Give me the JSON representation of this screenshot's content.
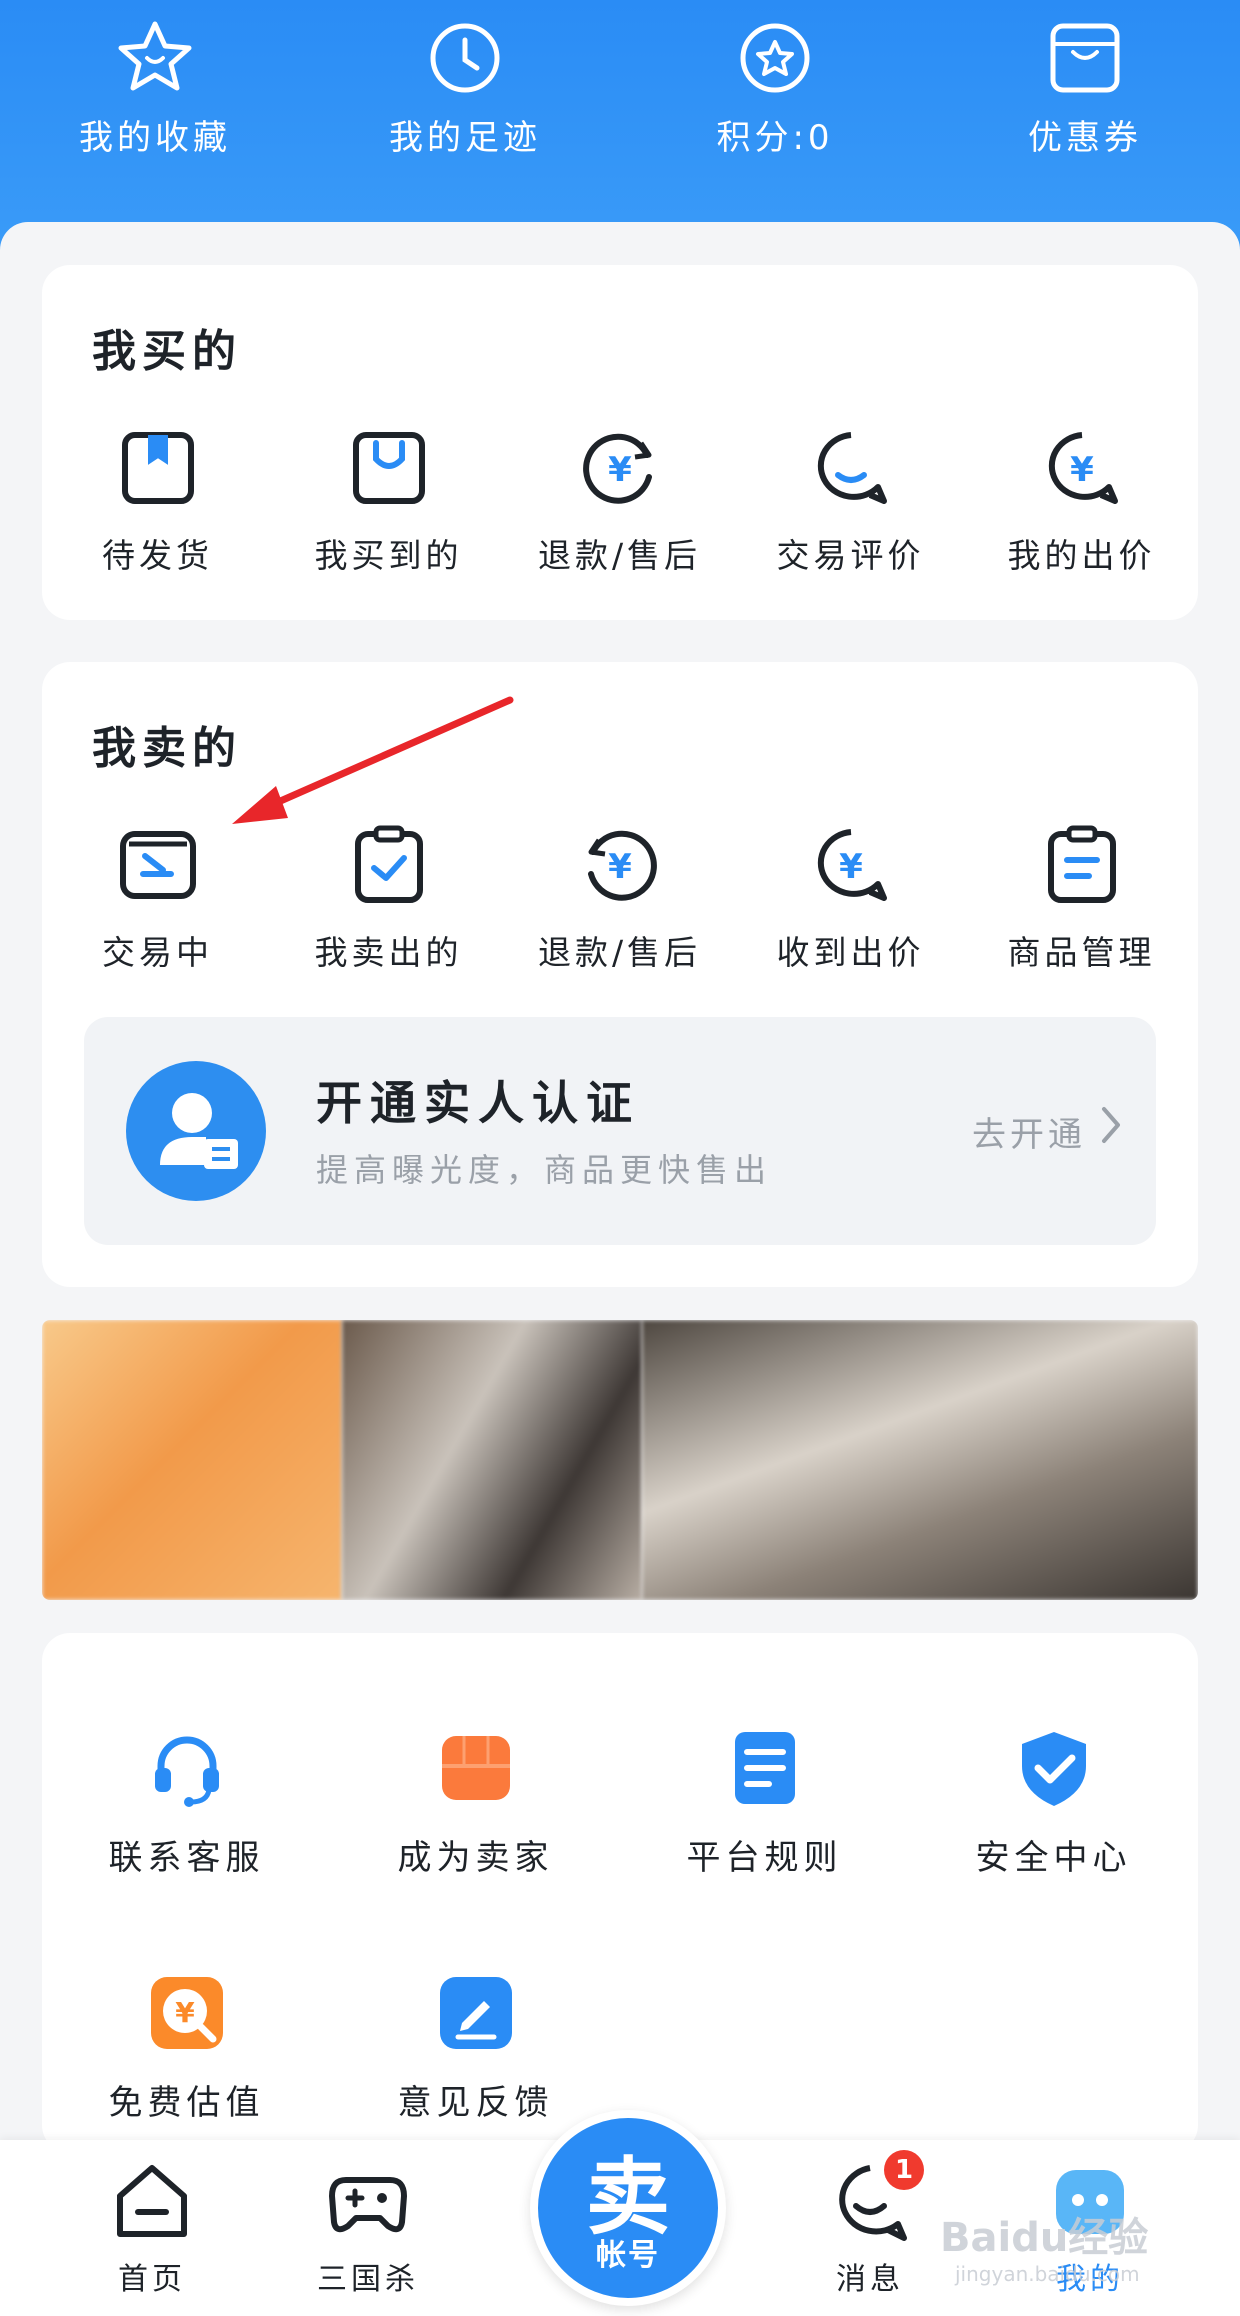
{
  "header": {
    "quick_links": [
      {
        "label": "我的收藏",
        "icon": "star-icon"
      },
      {
        "label": "我的足迹",
        "icon": "clock-icon"
      },
      {
        "label": "积分:0",
        "icon": "points-star-icon"
      },
      {
        "label": "优惠券",
        "icon": "coupon-icon"
      }
    ]
  },
  "bought": {
    "title": "我买的",
    "items": [
      {
        "label": "待发货",
        "icon": "package-icon"
      },
      {
        "label": "我买到的",
        "icon": "shopping-bag-icon"
      },
      {
        "label": "退款/售后",
        "icon": "refund-icon"
      },
      {
        "label": "交易评价",
        "icon": "review-bubble-icon"
      },
      {
        "label": "我的出价",
        "icon": "bid-yuan-icon"
      }
    ]
  },
  "sold": {
    "title": "我卖的",
    "items": [
      {
        "label": "交易中",
        "icon": "trading-icon"
      },
      {
        "label": "我卖出的",
        "icon": "clipboard-check-icon"
      },
      {
        "label": "退款/售后",
        "icon": "refund-icon"
      },
      {
        "label": "收到出价",
        "icon": "bid-yuan-icon"
      },
      {
        "label": "商品管理",
        "icon": "clipboard-list-icon"
      }
    ],
    "verify": {
      "title": "开通实人认证",
      "subtitle": "提高曝光度，商品更快售出",
      "action": "去开通"
    }
  },
  "services": {
    "items": [
      {
        "label": "联系客服",
        "icon": "headset-icon"
      },
      {
        "label": "成为卖家",
        "icon": "store-icon"
      },
      {
        "label": "平台规则",
        "icon": "document-icon"
      },
      {
        "label": "安全中心",
        "icon": "shield-check-icon"
      },
      {
        "label": "免费估值",
        "icon": "valuation-icon"
      },
      {
        "label": "意见反馈",
        "icon": "feedback-edit-icon"
      }
    ]
  },
  "tabbar": {
    "tabs": [
      {
        "label": "首页",
        "icon": "home-icon"
      },
      {
        "label": "三国杀",
        "icon": "gamepad-icon"
      },
      {
        "label": "消息",
        "icon": "message-icon"
      },
      {
        "label": "我的",
        "icon": "profile-icon"
      }
    ],
    "sell_button": {
      "big": "卖",
      "small": "帐号"
    },
    "message_badge": "1"
  },
  "watermark": {
    "main": "Baidu经验",
    "sub": "jingyan.baidu.com"
  },
  "colors": {
    "brand_blue": "#2a8cf5",
    "badge_red": "#f03a2e",
    "annotation_arrow": "#e8262a"
  }
}
